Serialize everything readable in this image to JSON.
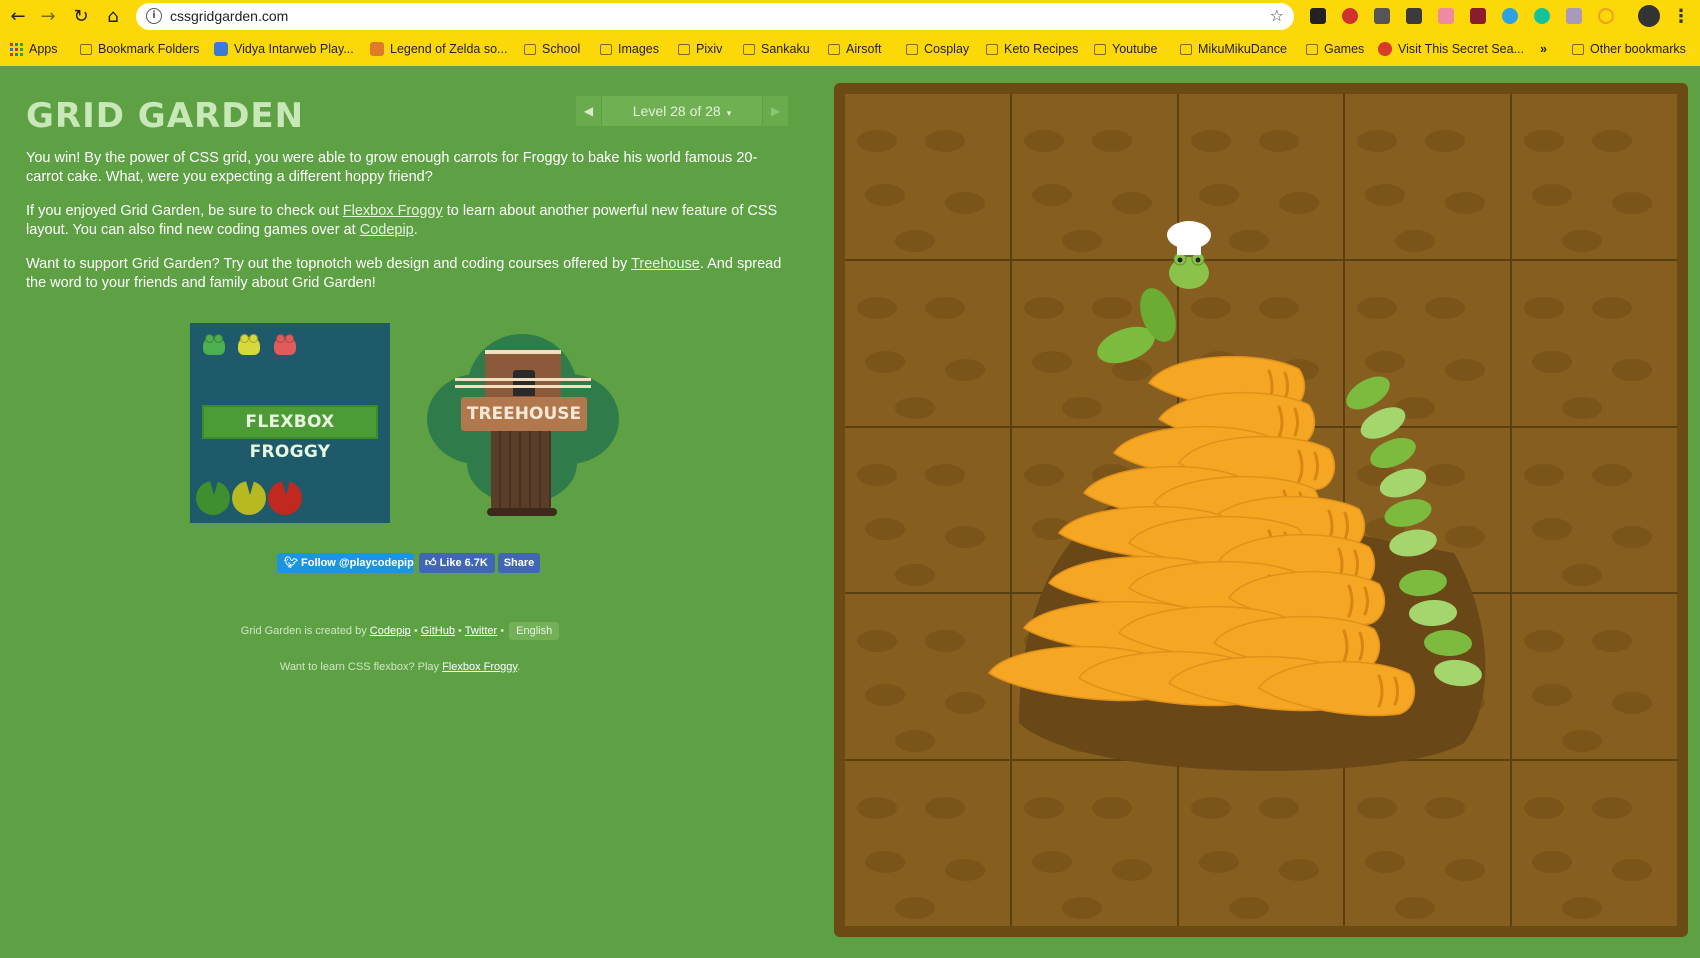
{
  "browser": {
    "url": "cssgridgarden.com",
    "bookmarks": [
      "Apps",
      "Bookmark Folders",
      "Vidya Intarweb Play...",
      "Legend of Zelda so...",
      "School",
      "Images",
      "Pixiv",
      "Sankaku",
      "Airsoft",
      "Cosplay",
      "Keto Recipes",
      "Youtube",
      "MikuMikuDance",
      "Games",
      "Visit This Secret Sea...",
      "»",
      "Other bookmarks"
    ],
    "icons": {
      "back": "arrow-left",
      "forward": "arrow-right",
      "reload": "refresh",
      "home": "house",
      "site_info": "info",
      "bookmark_star": "star",
      "menu": "vertical-dots"
    }
  },
  "page": {
    "title": "GRID GARDEN",
    "level": {
      "label": "Level 28 of 28",
      "caret": "▾",
      "prev": "◀",
      "next": "▶"
    },
    "p1": "You win! By the power of CSS grid, you were able to grow enough carrots for Froggy to bake his world famous 20-carrot cake. What, were you expecting a different hoppy friend?",
    "p2": {
      "before": "If you enjoyed Grid Garden, be sure to check out ",
      "link1": "Flexbox Froggy",
      "middle": " to learn about another powerful new feature of CSS layout. You can also find new coding games over at ",
      "link2": "Codepip",
      "after": "."
    },
    "p3": {
      "before": "Want to support Grid Garden? Try out the topnotch web design and coding courses offered by ",
      "link": "Treehouse",
      "after": ". And spread the word to your friends and family about Grid Garden!"
    },
    "promos": {
      "froggy": "FLEXBOX FROGGY",
      "treehouse": "TREEHOUSE"
    },
    "social": {
      "twitter": "Follow @playcodepip",
      "fb_like": "Like 6.7K",
      "fb_share": "Share"
    },
    "footer": {
      "created_by": "Grid Garden is created by ",
      "codepip": "Codepip",
      "sep": " • ",
      "github": "GitHub",
      "twitter": "Twitter",
      "language": "English",
      "flexbox_prompt": "Want to learn CSS flexbox? Play ",
      "flexbox_link": "Flexbox Froggy",
      "period": "."
    },
    "colors": {
      "background": "#5ea145",
      "garden_border": "#6b4a14",
      "soil": "#865e20",
      "carrot": "#f5a623",
      "leaf": "#8bc34a",
      "browser_frame": "#fdd808"
    }
  }
}
